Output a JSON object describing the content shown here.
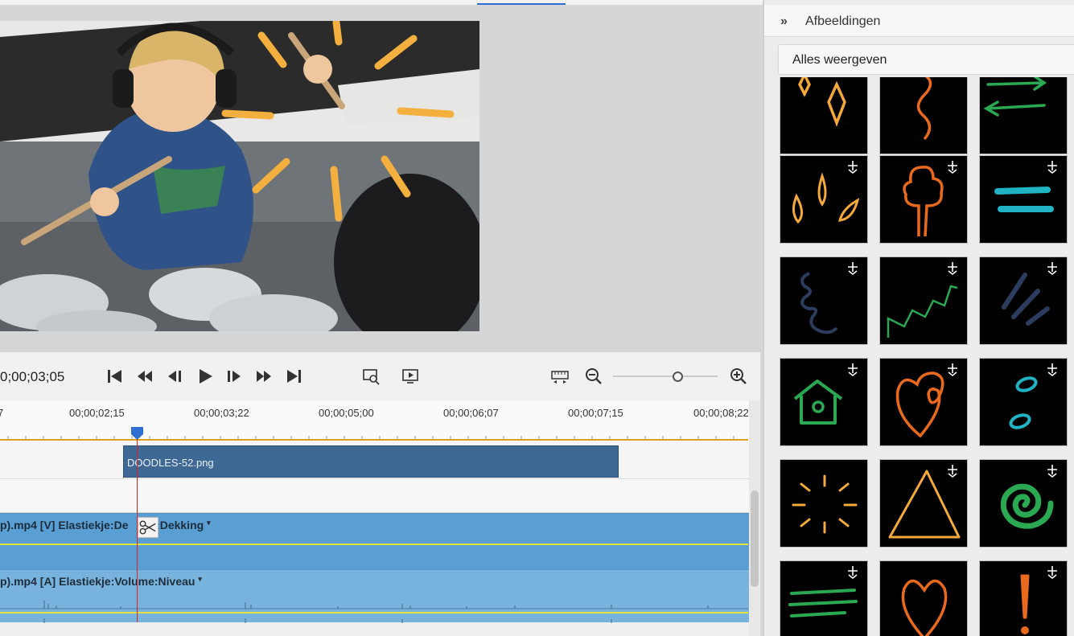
{
  "timeline": {
    "timecode": "0;00;03;05",
    "ruler_labels": [
      "7",
      "00;00;02;15",
      "00;00;03;22",
      "00;00;05;00",
      "00;00;06;07",
      "00;00;07;15",
      "00;00;08;22"
    ]
  },
  "tracks": {
    "overlay_clip": "DOODLES-52.png",
    "video_label": "p).mp4 [V] Elastiekje:De",
    "video_label_rest": "g:Dekking",
    "audio_label": "p).mp4 [A] Elastiekje:Volume:Niveau"
  },
  "panel": {
    "title": "Afbeeldingen",
    "filter": "Alles weergeven"
  },
  "transport_icons": [
    "go-to-start-icon",
    "previous-frame-icon",
    "step-back-icon",
    "play-icon",
    "step-forward-icon",
    "next-frame-icon",
    "go-to-end-icon",
    "fullscreen-preview-icon",
    "render-preview-icon",
    "fit-timeline-icon",
    "zoom-out-icon",
    "zoom-in-icon"
  ],
  "colors": {
    "accent": "#2d6fd0",
    "video_track": "#5a9fd4",
    "audio_track": "#78b3de",
    "overlay_clip": "#3f6995",
    "playhead": "#e02020",
    "doodle_orange": "#f5a93a",
    "doodle_teal": "#1fb3c4",
    "doodle_green": "#2aa852",
    "doodle_navy": "#2b3c5e"
  }
}
